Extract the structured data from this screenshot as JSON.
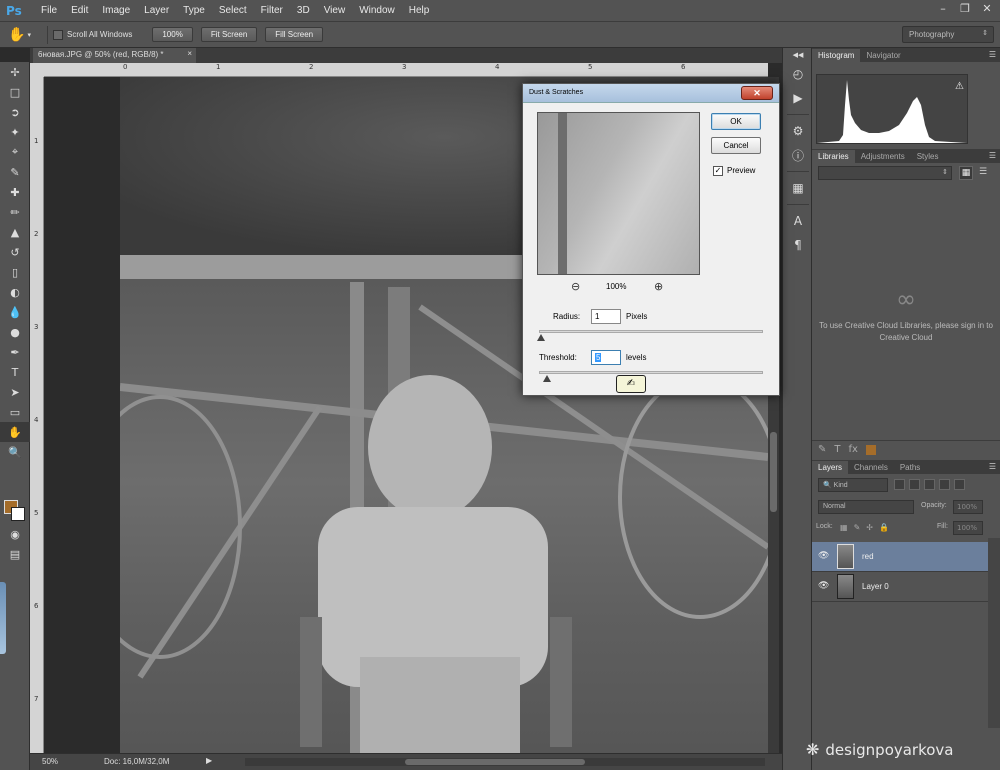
{
  "app": {
    "logo": "Ps",
    "menu": [
      "File",
      "Edit",
      "Image",
      "Layer",
      "Type",
      "Select",
      "Filter",
      "3D",
      "View",
      "Window",
      "Help"
    ]
  },
  "options_bar": {
    "scroll_all_windows": "Scroll All Windows",
    "btn_100": "100%",
    "btn_fit_screen": "Fit Screen",
    "btn_fill_screen": "Fill Screen",
    "workspace": "Photography"
  },
  "document": {
    "tab_title": "6новая.JPG @ 50% (red, RGB/8) *",
    "ruler_h": [
      "0",
      "1",
      "2",
      "3",
      "4",
      "5",
      "6"
    ],
    "ruler_v": [
      "1",
      "2",
      "3",
      "4",
      "5",
      "6",
      "7"
    ],
    "status_zoom": "50%",
    "status_doc": "Doc: 16,0M/32,0M"
  },
  "panels": {
    "histogram_tabs": [
      "Histogram",
      "Navigator"
    ],
    "library_tabs": [
      "Libraries",
      "Adjustments",
      "Styles"
    ],
    "cc_message": "To use Creative Cloud Libraries, please sign in to Creative Cloud",
    "layers_tabs": [
      "Layers",
      "Channels",
      "Paths"
    ],
    "kind_filter": "Kind",
    "blend_mode": "Normal",
    "opacity_label": "Opacity:",
    "opacity_value": "100%",
    "lock_label": "Lock:",
    "fill_label": "Fill:",
    "fill_value": "100%",
    "layers": [
      {
        "name": "red",
        "selected": true
      },
      {
        "name": "Layer 0",
        "selected": false
      }
    ]
  },
  "dialog": {
    "title": "Dust & Scratches",
    "ok": "OK",
    "cancel": "Cancel",
    "preview_label": "Preview",
    "preview_checked": true,
    "zoom": "100%",
    "radius_label": "Radius:",
    "radius_value": "1",
    "radius_unit": "Pixels",
    "threshold_label": "Threshold:",
    "threshold_value": "5",
    "threshold_unit": "levels"
  },
  "watermark": "designpoyarkova",
  "colors": {
    "foreground": "#a56d2a",
    "background": "#ffffff",
    "selected_layer": "#6b7f9c"
  }
}
